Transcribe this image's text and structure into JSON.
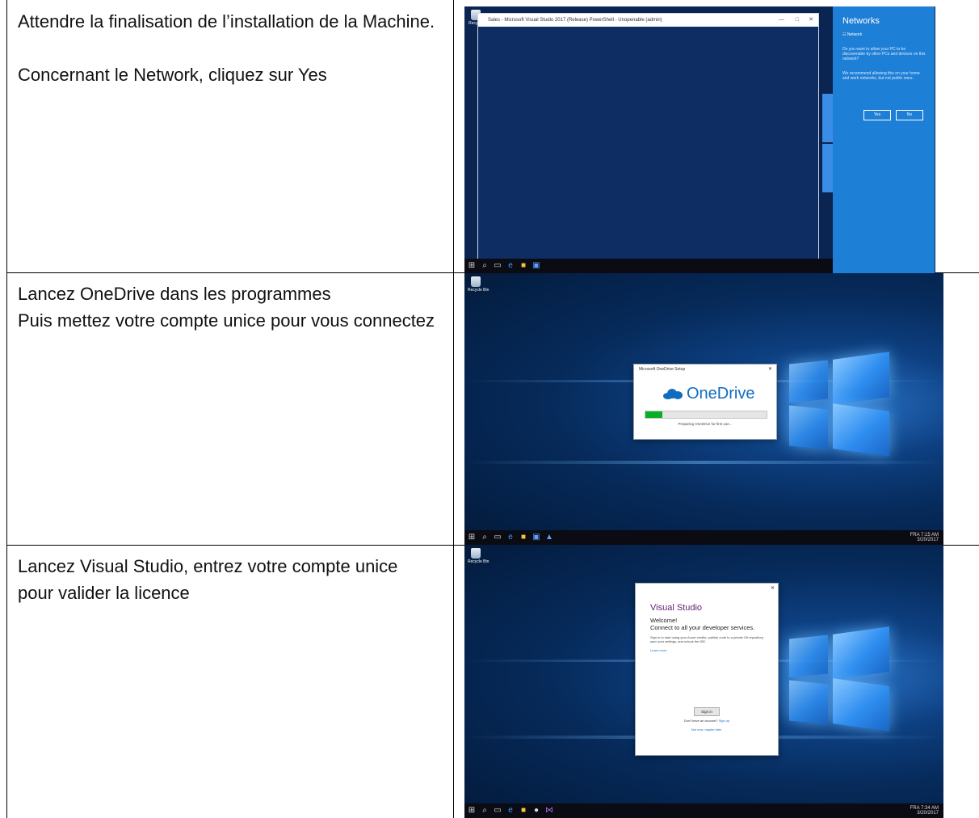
{
  "rows": [
    {
      "lines": [
        "Attendre la finalisation de l’installation de la Machine.",
        "Concernant le Network, cliquez sur Yes"
      ],
      "screenshot": {
        "window_title": "Sales - Microsoft Visual Studio 2017 (Release) PowerShell - Unopenable (admin)",
        "panel_title": "Networks",
        "panel_network": "Network",
        "question": "Do you want to allow your PC to be discoverable by other PCs and devices on this network?",
        "recommendation": "We recommend allowing this on your home and work networks, but not public ones.",
        "yes_label": "Yes",
        "no_label": "No",
        "recycle_label": "Recycle"
      }
    },
    {
      "lines": [
        "Lancez OneDrive dans les programmes",
        "Puis mettez votre compte unice pour vous connectez"
      ],
      "screenshot": {
        "dialog_title": "Microsoft OneDrive Setup",
        "brand": "OneDrive",
        "progress": 0.14,
        "status": "Preparing OneDrive for first use...",
        "recycle_label": "Recycle Bin",
        "tray_time": "7:15 AM",
        "tray_date": "3/20/2017",
        "tray_lang": "FRA"
      }
    },
    {
      "lines": [
        "Lancez Visual Studio, entrez votre compte unice pour valider la licence"
      ],
      "screenshot": {
        "brand": "Visual Studio",
        "welcome": "Welcome!",
        "connect": "Connect to all your developer services.",
        "description": "Sign in to start using your Azure credits, publish code to a private Git repository, sync your settings, and unlock the IDE.",
        "learn_more": "Learn more",
        "sign_in": "Sign in",
        "no_account": "Don't have an account?",
        "sign_up": "Sign up",
        "not_now": "Not now, maybe later.",
        "recycle_label": "Recycle Bin",
        "tray_time": "7:34 AM",
        "tray_date": "3/20/2017",
        "tray_lang": "FRA"
      }
    }
  ]
}
